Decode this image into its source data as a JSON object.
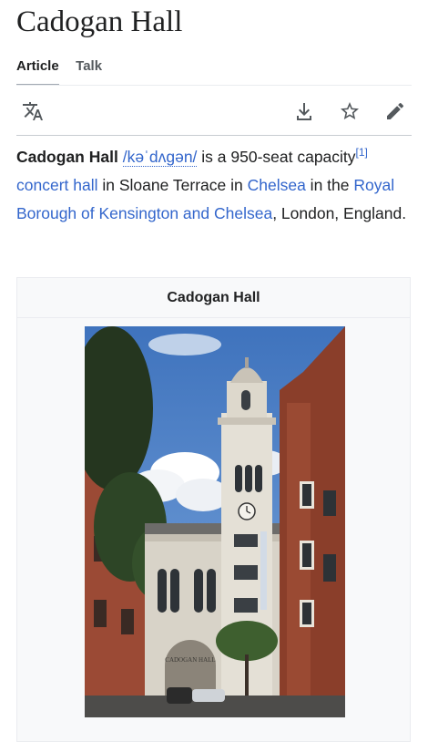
{
  "page": {
    "title": "Cadogan Hall"
  },
  "tabs": [
    {
      "label": "Article",
      "active": true
    },
    {
      "label": "Talk",
      "active": false
    }
  ],
  "toolbar": {
    "language": "language-icon",
    "download": "download-icon",
    "watch": "star-icon",
    "edit": "pencil-icon"
  },
  "lead": {
    "subject": "Cadogan Hall",
    "ipa": "/kəˈdʌɡən/",
    "text1": " is a 950-seat capacity",
    "ref": "[1]",
    "link1": "concert hall",
    "text2": " in Sloane Terrace in ",
    "link2": "Chelsea",
    "text3": " in the ",
    "link3": "Royal Borough of Kensington and Chelsea",
    "text4": ", London, England."
  },
  "infobox": {
    "title": "Cadogan Hall",
    "image_alt": "Cadogan Hall building",
    "sign_text": "CADOGAN HALL"
  },
  "colors": {
    "link": "#3366cc",
    "text": "#202122",
    "sky": "#4a7fc4"
  }
}
